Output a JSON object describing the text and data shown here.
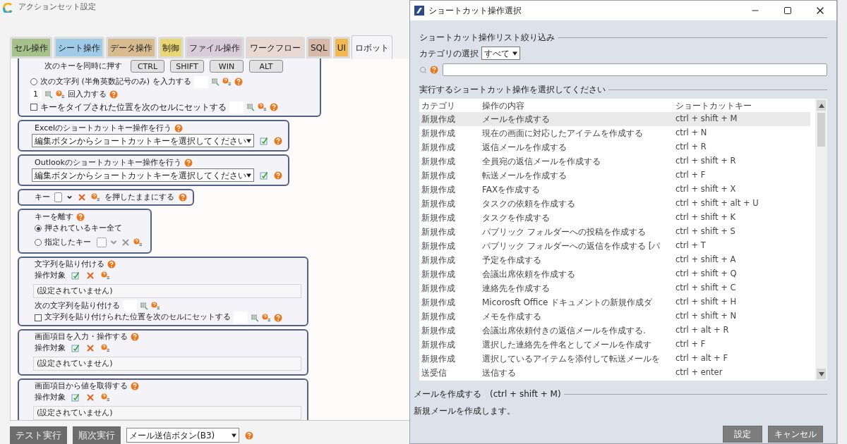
{
  "window": {
    "title": "アクションセット設定"
  },
  "tabs": [
    {
      "label": "セル操作",
      "color": "#a6c28a",
      "selected": false
    },
    {
      "label": "シート操作",
      "color": "#9fcbe8",
      "selected": false
    },
    {
      "label": "データ操作",
      "color": "#d8bb8e",
      "selected": false
    },
    {
      "label": "制御",
      "color": "#e9d672",
      "selected": false
    },
    {
      "label": "ファイル操作",
      "color": "#d9cbd9",
      "selected": false
    },
    {
      "label": "ワークフロー",
      "color": "#e8d9d0",
      "selected": false
    },
    {
      "label": "SQL",
      "color": "#d8b8a8",
      "selected": false
    },
    {
      "label": "UI",
      "color": "#f0b84e",
      "selected": false
    },
    {
      "label": "ロボット",
      "color": "#f5f5f7",
      "selected": true
    }
  ],
  "sections": [
    {
      "kind": "keys",
      "label": "次のキーを同時に押す",
      "keys": [
        "CTRL",
        "SHIFT",
        "WIN",
        "ALT"
      ],
      "radio": {
        "label": "次の文字列 (半角英数記号のみ) を入力する",
        "selected": false
      },
      "count": "1",
      "count_label": "回入力する",
      "checkbox": {
        "label": "キーをタイプされた位置を次のセルにセットする",
        "checked": false
      }
    },
    {
      "kind": "dropdown",
      "title": "Excelのショートカットキー操作を行う",
      "value": "編集ボタンからショートカットキーを選択してください"
    },
    {
      "kind": "dropdown",
      "title": "Outlookのショートカットキー操作を行う",
      "value": "編集ボタンからショートカットキーを選択してください"
    },
    {
      "kind": "hold",
      "label": "キー",
      "suffix": "を押したままにする"
    },
    {
      "kind": "release",
      "title": "キーを離す",
      "options": [
        {
          "label": "押されているキー全て",
          "selected": true
        },
        {
          "label": "指定したキー",
          "selected": false
        }
      ]
    },
    {
      "kind": "paste",
      "title": "文字列を貼り付ける",
      "target_label": "操作対象",
      "target_value": "(設定されていません)",
      "paste_label": "次の文字列を貼り付ける",
      "checkbox": {
        "label": "文字列を貼り付けられた位置を次のセルにセットする",
        "checked": false
      }
    },
    {
      "kind": "target",
      "title": "画面項目を入力・操作する",
      "target_label": "操作対象",
      "target_value": "(設定されていません)"
    },
    {
      "kind": "target",
      "title": "画面項目から値を取得する",
      "target_label": "操作対象",
      "target_value": "(設定されていません)"
    }
  ],
  "bottom_bar": {
    "buttons": [
      "テスト実行",
      "順次実行"
    ],
    "select": "メール送信ボタン(B3)"
  },
  "dialog": {
    "title": "ショートカット操作選択",
    "filter_title": "ショートカット操作リスト絞り込み",
    "category_label": "カテゴリの選択",
    "category_value": "すべて",
    "list_title": "実行するショートカット操作を選択してください",
    "columns": [
      "カテゴリ",
      "操作の内容",
      "ショートカットキー"
    ],
    "rows": [
      {
        "category": "新規作成",
        "action": "メールを作成する",
        "shortcut": "ctrl + shift + M",
        "selected": true
      },
      {
        "category": "新規作成",
        "action": "現在の画面に対応したアイテムを作成する",
        "shortcut": "ctrl + N",
        "selected": false
      },
      {
        "category": "新規作成",
        "action": "返信メールを作成する",
        "shortcut": "ctrl + R",
        "selected": false
      },
      {
        "category": "新規作成",
        "action": "全員宛の返信メールを作成する",
        "shortcut": "ctrl + shift + R",
        "selected": false
      },
      {
        "category": "新規作成",
        "action": "転送メールを作成する",
        "shortcut": "ctrl + F",
        "selected": false
      },
      {
        "category": "新規作成",
        "action": "FAXを作成する",
        "shortcut": "ctrl + shift + X",
        "selected": false
      },
      {
        "category": "新規作成",
        "action": "タスクの依頼を作成する",
        "shortcut": "ctrl + shift + alt + U",
        "selected": false
      },
      {
        "category": "新規作成",
        "action": "タスクを作成する",
        "shortcut": "ctrl + shift + K",
        "selected": false
      },
      {
        "category": "新規作成",
        "action": "パブリック フォルダーへの投稿を作成する",
        "shortcut": "ctrl + shift + S",
        "selected": false
      },
      {
        "category": "新規作成",
        "action": "パブリック フォルダーへの返信を作成する [パ",
        "shortcut": "ctrl + T",
        "selected": false
      },
      {
        "category": "新規作成",
        "action": "予定を作成する",
        "shortcut": "ctrl + shift + A",
        "selected": false
      },
      {
        "category": "新規作成",
        "action": "会議出席依頼を作成する",
        "shortcut": "ctrl + shift + Q",
        "selected": false
      },
      {
        "category": "新規作成",
        "action": "連絡先を作成する",
        "shortcut": "ctrl + shift + C",
        "selected": false
      },
      {
        "category": "新規作成",
        "action": "Micorosft Office ドキュメントの新規作成ダ",
        "shortcut": "ctrl + shift + H",
        "selected": false
      },
      {
        "category": "新規作成",
        "action": "メモを作成する",
        "shortcut": "ctrl + shift + N",
        "selected": false
      },
      {
        "category": "新規作成",
        "action": "会議出席依頼付きの返信メールを作成する.",
        "shortcut": "ctrl + alt + R",
        "selected": false
      },
      {
        "category": "新規作成",
        "action": "選択した連絡先を件名としてメールを作成す",
        "shortcut": "ctrl + F",
        "selected": false
      },
      {
        "category": "新規作成",
        "action": "選択しているアイテムを添付して転送メールを",
        "shortcut": "ctrl + alt + F",
        "selected": false
      },
      {
        "category": "送受信",
        "action": "送信する",
        "shortcut": "ctrl + enter",
        "selected": false
      }
    ],
    "detail_title": "メールを作成する",
    "detail_shortcut": "(ctrl + shift + M)",
    "detail_text": "新規メールを作成します。",
    "buttons": [
      "設定",
      "キャンセル"
    ]
  }
}
